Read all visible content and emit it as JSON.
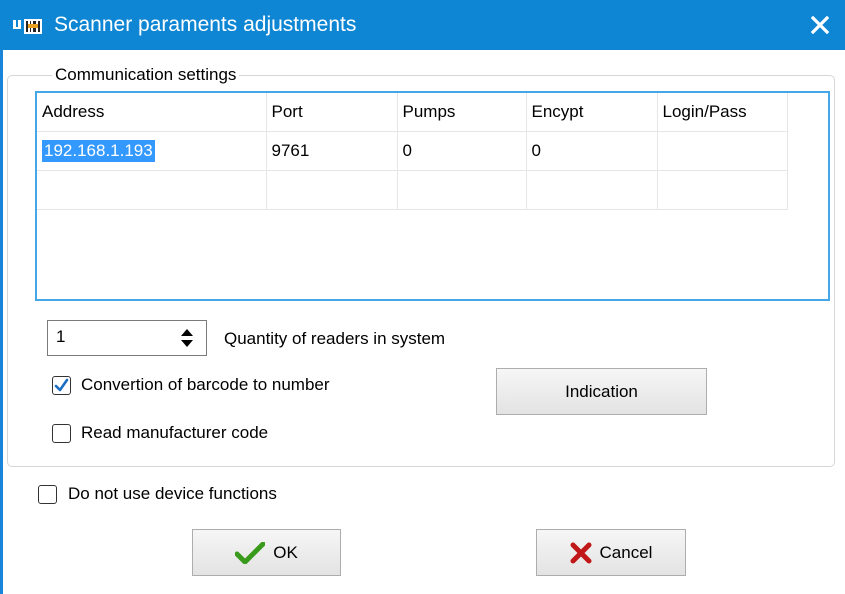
{
  "window": {
    "title": "Scanner paraments adjustments"
  },
  "group": {
    "legend": "Communication settings"
  },
  "grid": {
    "columns": [
      "Address",
      "Port",
      "Pumps",
      "Encypt",
      "Login/Pass"
    ],
    "rows": [
      [
        "192.168.1.193",
        "9761",
        "0",
        "0",
        ""
      ],
      [
        "",
        "",
        "",
        "",
        ""
      ]
    ]
  },
  "readers": {
    "quantity": "1",
    "label": "Quantity of readers in system"
  },
  "options": {
    "convertion_label": "Convertion of barcode to number",
    "convertion_checked": true,
    "manufacturer_label": "Read manufacturer code",
    "manufacturer_checked": false,
    "no_device_label": "Do not use device functions",
    "no_device_checked": false
  },
  "buttons": {
    "indication": "Indication",
    "ok": "OK",
    "cancel": "Cancel"
  },
  "colors": {
    "titlebar": "#0e86d4",
    "selection": "#3399ff",
    "grid_border": "#46a7e8"
  }
}
